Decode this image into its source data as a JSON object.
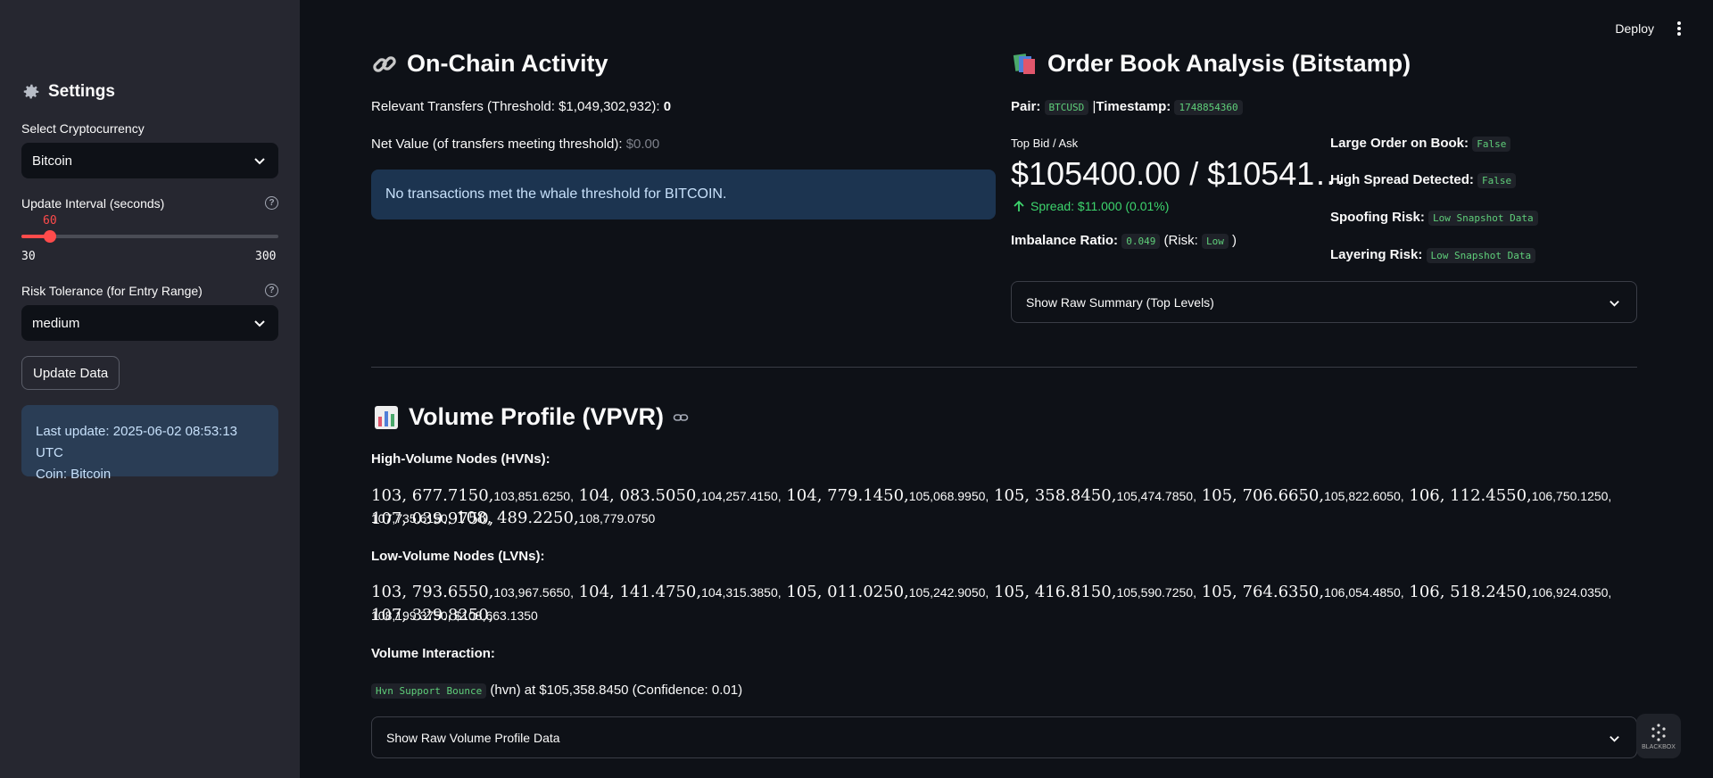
{
  "sidebar": {
    "title": "Settings",
    "crypto_label": "Select Cryptocurrency",
    "crypto_value": "Bitcoin",
    "interval_label": "Update Interval (seconds)",
    "interval_value": "60",
    "interval_fraction": 0.1111,
    "interval_min": "30",
    "interval_max": "300",
    "risk_label": "Risk Tolerance (for Entry Range)",
    "risk_value": "medium",
    "update_button": "Update Data",
    "last_update": "Last update: 2025-06-02 08:53:13 UTC",
    "coin": "Coin: Bitcoin"
  },
  "header": {
    "deploy": "Deploy"
  },
  "onchain": {
    "title": "On-Chain Activity",
    "transfers_label": "Relevant Transfers (Threshold: $1,049,302,932):",
    "transfers_value": "0",
    "net_value_label": "Net Value (of transfers meeting threshold):",
    "net_value": "$0.00",
    "alert": "No transactions met the whale threshold for BITCOIN."
  },
  "orderbook": {
    "title": "Order Book Analysis (Bitstamp)",
    "pair_label": "Pair:",
    "pair_value": "BTCUSD",
    "separator": "|",
    "timestamp_label": "Timestamp:",
    "timestamp_value": "1748854360",
    "top_bid_ask_label": "Top Bid / Ask",
    "top_bid_ask_value": "$105400.00 / $10541…",
    "spread": "Spread: $11.000 (0.01%)",
    "imbalance_label": "Imbalance Ratio:",
    "imbalance_value": "0.049",
    "risk_prefix": "(Risk:",
    "risk_value": "Low",
    "risk_suffix": ")",
    "large_order_label": "Large Order on Book:",
    "large_order_value": "False",
    "high_spread_label": "High Spread Detected:",
    "high_spread_value": "False",
    "spoofing_label": "Spoofing Risk:",
    "spoofing_value": "Low Snapshot Data",
    "layering_label": "Layering Risk:",
    "layering_value": "Low Snapshot Data",
    "expander": "Show Raw Summary (Top Levels)"
  },
  "volume": {
    "title": "Volume Profile (VPVR)",
    "hvn_label": "High-Volume Nodes (HVNs):",
    "hvn_line1": [
      {
        "t": "103, 677.7150,",
        "s": false
      },
      {
        "t": "103,851.6250,",
        "s": true
      },
      {
        "t": " 104, 083.5050,",
        "s": false
      },
      {
        "t": "104,257.4150,",
        "s": true
      },
      {
        "t": " 104, 779.1450,",
        "s": false
      },
      {
        "t": "105,068.9950,",
        "s": true
      },
      {
        "t": " 105, 358.8450,",
        "s": false
      },
      {
        "t": "105,474.7850,",
        "s": true
      },
      {
        "t": " 105, 706.6650,",
        "s": false
      },
      {
        "t": "105,822.6050,",
        "s": true
      },
      {
        "t": " 106, 112.4550,",
        "s": false
      },
      {
        "t": "106,750.1250,",
        "s": true
      },
      {
        "t": " 107, 039.9750,",
        "s": false
      }
    ],
    "hvn_line2": [
      {
        "t": "107,735.6150,",
        "s": true
      },
      {
        "t": " 108, 489.2250,",
        "s": false
      },
      {
        "t": "108,779.0750",
        "s": true
      }
    ],
    "lvn_label": "Low-Volume Nodes (LVNs):",
    "lvn_line1": [
      {
        "t": "103, 793.6550,",
        "s": false
      },
      {
        "t": "103,967.5650,",
        "s": true
      },
      {
        "t": " 104, 141.4750,",
        "s": false
      },
      {
        "t": "104,315.3850,",
        "s": true
      },
      {
        "t": " 105, 011.0250,",
        "s": false
      },
      {
        "t": "105,242.9050,",
        "s": true
      },
      {
        "t": " 105, 416.8150,",
        "s": false
      },
      {
        "t": "105,590.7250,",
        "s": true
      },
      {
        "t": " 105, 764.6350,",
        "s": false
      },
      {
        "t": "106,054.4850,",
        "s": true
      },
      {
        "t": " 106, 518.2450,",
        "s": false
      },
      {
        "t": "106,924.0350,",
        "s": true
      },
      {
        "t": " 107, 329.8250,",
        "s": false
      }
    ],
    "lvn_line2": [
      {
        "t": "108,199.3750, $108,663.1350",
        "s": true
      }
    ],
    "interaction_label": "Volume Interaction:",
    "interaction_badge": "Hvn Support Bounce",
    "interaction_text": "(hvn) at $105,358.8450 (Confidence: 0.01)",
    "expander": "Show Raw Volume Profile Data"
  },
  "watermark": "BLACKBOX"
}
